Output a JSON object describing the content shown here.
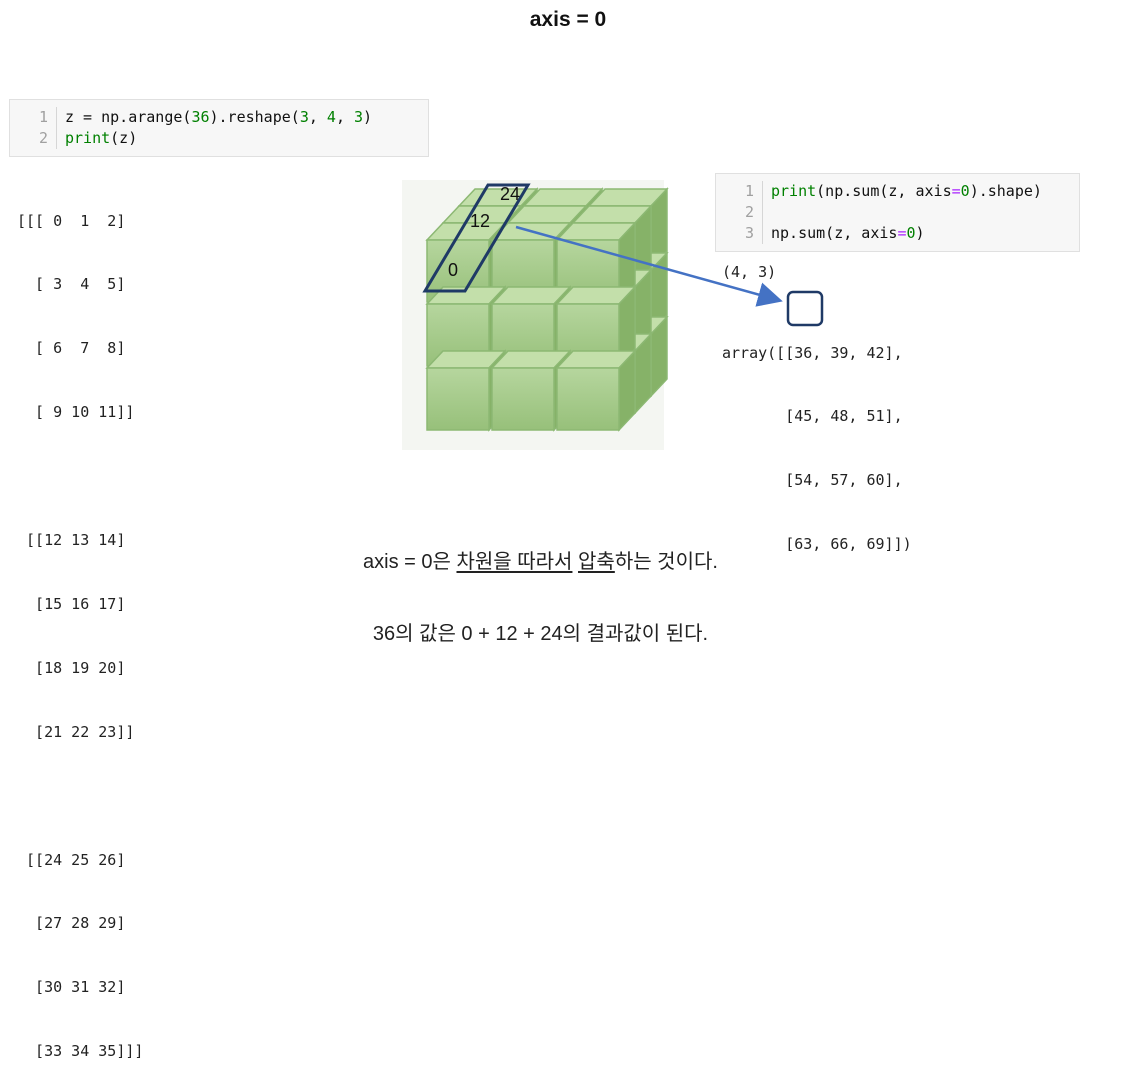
{
  "title": "axis = 0",
  "code_cell_1": {
    "lines": [
      {
        "n": "1",
        "parts": [
          "z = np.arange(",
          "36",
          ").reshape(",
          "3",
          ", ",
          "4",
          ", ",
          "3",
          ")"
        ]
      },
      {
        "n": "2",
        "parts": [
          "print",
          "(z)"
        ]
      }
    ]
  },
  "output_1": {
    "lines": [
      "[[[ 0  1  2]",
      "  [ 3  4  5]",
      "  [ 6  7  8]",
      "  [ 9 10 11]]",
      "",
      " [[12 13 14]",
      "  [15 16 17]",
      "  [18 19 20]",
      "  [21 22 23]]",
      "",
      " [[24 25 26]",
      "  [27 28 29]",
      "  [30 31 32]",
      "  [33 34 35]]]"
    ]
  },
  "cube": {
    "labels": {
      "a": "24",
      "b": "12",
      "c": "0"
    },
    "cube_face_color": "#a3c98a",
    "highlight_color": "#1f3a66",
    "arrow_color": "#4472c4"
  },
  "code_cell_2": {
    "lines": [
      {
        "n": "1",
        "parts": [
          "print",
          "(np.sum(z, axis",
          "=",
          "0",
          ").shape)"
        ]
      },
      {
        "n": "2",
        "parts": [
          ""
        ]
      },
      {
        "n": "3",
        "parts": [
          "np.sum(z, axis",
          "=",
          "0",
          ")"
        ]
      }
    ]
  },
  "output_2": {
    "shape": "(4, 3)",
    "array_lines": [
      "array([[36, 39, 42],",
      "       [45, 48, 51],",
      "       [54, 57, 60],",
      "       [63, 66, 69]])"
    ]
  },
  "captions": {
    "line1_prefix": "axis = 0은 ",
    "line1_underlined_a": "차원을 따라서",
    "line1_space": " ",
    "line1_underlined_b": "압축",
    "line1_suffix": "하는 것이다.",
    "line2": "36의 값은 0 + 12 + 24의 결과값이 된다."
  }
}
